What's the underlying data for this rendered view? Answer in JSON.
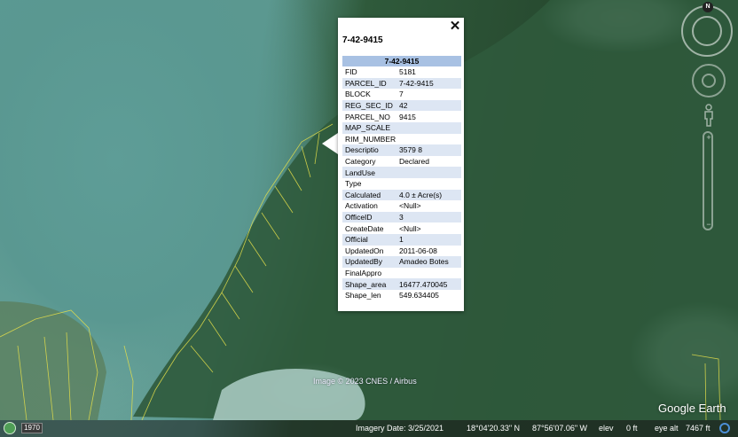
{
  "popup": {
    "title": "7-42-9415",
    "table_header": "7-42-9415",
    "close_glyph": "✕",
    "rows": [
      {
        "k": "FID",
        "v": "5181"
      },
      {
        "k": "PARCEL_ID",
        "v": "7-42-9415"
      },
      {
        "k": "BLOCK",
        "v": "7"
      },
      {
        "k": "REG_SEC_ID",
        "v": "42"
      },
      {
        "k": "PARCEL_NO",
        "v": "9415"
      },
      {
        "k": "MAP_SCALE",
        "v": ""
      },
      {
        "k": "RIM_NUMBER",
        "v": ""
      },
      {
        "k": "Descriptio",
        "v": "3579 8"
      },
      {
        "k": "Category",
        "v": "Declared"
      },
      {
        "k": "LandUse",
        "v": ""
      },
      {
        "k": "Type",
        "v": ""
      },
      {
        "k": "Calculated",
        "v": "4.0 ± Acre(s)"
      },
      {
        "k": "Activation",
        "v": "<Null>"
      },
      {
        "k": "OfficeID",
        "v": "3"
      },
      {
        "k": "CreateDate",
        "v": "<Null>"
      },
      {
        "k": "Official",
        "v": "1"
      },
      {
        "k": "UpdatedOn",
        "v": "2011-06-08"
      },
      {
        "k": "UpdatedBy",
        "v": "Amadeo Botes"
      },
      {
        "k": "FinalAppro",
        "v": ""
      },
      {
        "k": "Shape_area",
        "v": "16477.470045"
      },
      {
        "k": "Shape_len",
        "v": "549.634405"
      }
    ]
  },
  "map": {
    "copyright": "Image © 2023 CNES / Airbus",
    "brand": "Google Earth",
    "compass_label": "N",
    "parcel_line_color": "#e6e04a"
  },
  "statusbar": {
    "year": "1970",
    "imagery_date": "Imagery Date: 3/25/2021",
    "lat": "18°04'20.33\" N",
    "lon": "87°56'07.06\" W",
    "elev_label": "elev",
    "elev_value": "0 ft",
    "eye_alt_label": "eye alt",
    "eye_alt_value": "7467 ft"
  },
  "icons": {
    "history": "historical-imagery-icon",
    "streaming": "streaming-status-icon",
    "person": "street-view-person-icon"
  }
}
